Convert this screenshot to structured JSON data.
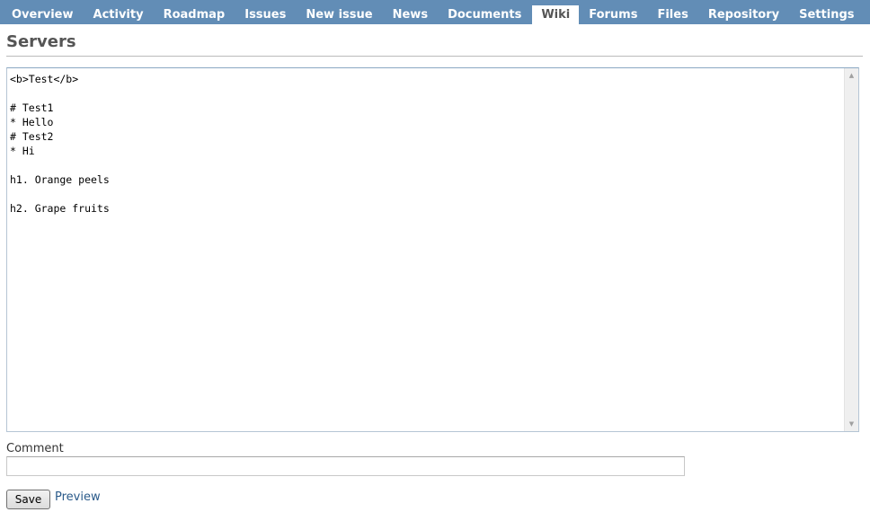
{
  "nav": {
    "items": [
      {
        "label": "Overview"
      },
      {
        "label": "Activity"
      },
      {
        "label": "Roadmap"
      },
      {
        "label": "Issues"
      },
      {
        "label": "New issue"
      },
      {
        "label": "News"
      },
      {
        "label": "Documents"
      },
      {
        "label": "Wiki"
      },
      {
        "label": "Forums"
      },
      {
        "label": "Files"
      },
      {
        "label": "Repository"
      },
      {
        "label": "Settings"
      }
    ],
    "selected": "Wiki"
  },
  "page": {
    "title": "Servers"
  },
  "editor": {
    "content": "<b>Test</b>\n\n# Test1\n* Hello\n# Test2\n* Hi\n\nh1. Orange peels\n\nh2. Grape fruits"
  },
  "comment": {
    "label": "Comment",
    "value": ""
  },
  "actions": {
    "save_label": "Save",
    "preview_label": "Preview"
  },
  "colors": {
    "nav_background": "#628db6",
    "link": "#2a5a8a"
  },
  "icons": {
    "scroll_up": "scroll-up-arrow-icon",
    "scroll_down": "scroll-down-arrow-icon"
  }
}
